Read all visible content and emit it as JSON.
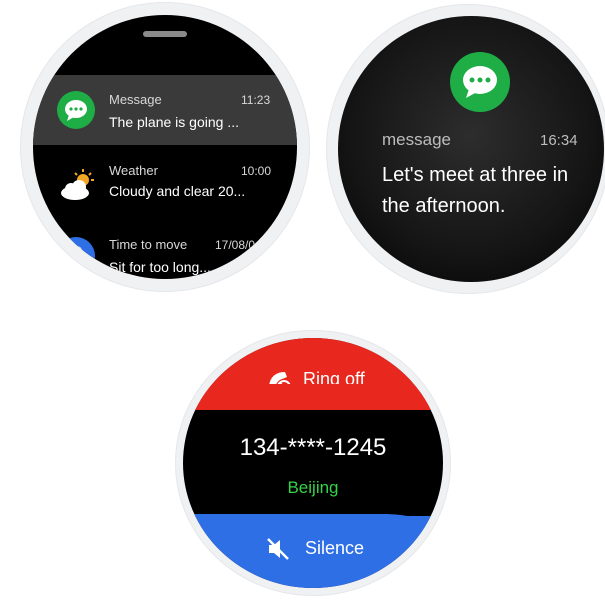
{
  "notifications_watch": {
    "items": [
      {
        "title": "Message",
        "time": "11:23",
        "body": "The plane is going ...",
        "icon": "chat-bubble-icon",
        "color": "#1fae46"
      },
      {
        "title": "Weather",
        "time": "10:00",
        "body": "Cloudy and clear 20...",
        "icon": "cloudy-sun-icon",
        "color": "#f5a623"
      },
      {
        "title": "Time to move",
        "time": "17/08/0",
        "body": "Sit for too long...",
        "icon": "bell-icon",
        "color": "#2f6fe6"
      }
    ]
  },
  "message_watch": {
    "label": "message",
    "time": "16:34",
    "text": "Let's meet at three in the afternoon.",
    "icon": "chat-bubble-icon",
    "accent": "#1fae46"
  },
  "call_watch": {
    "ring_off_label": "Ring off",
    "number": "134-****-1245",
    "location": "Beijing",
    "silence_label": "Silence",
    "ring_off_color": "#e8281e",
    "silence_color": "#2f6fe6",
    "location_color": "#35d24a"
  }
}
